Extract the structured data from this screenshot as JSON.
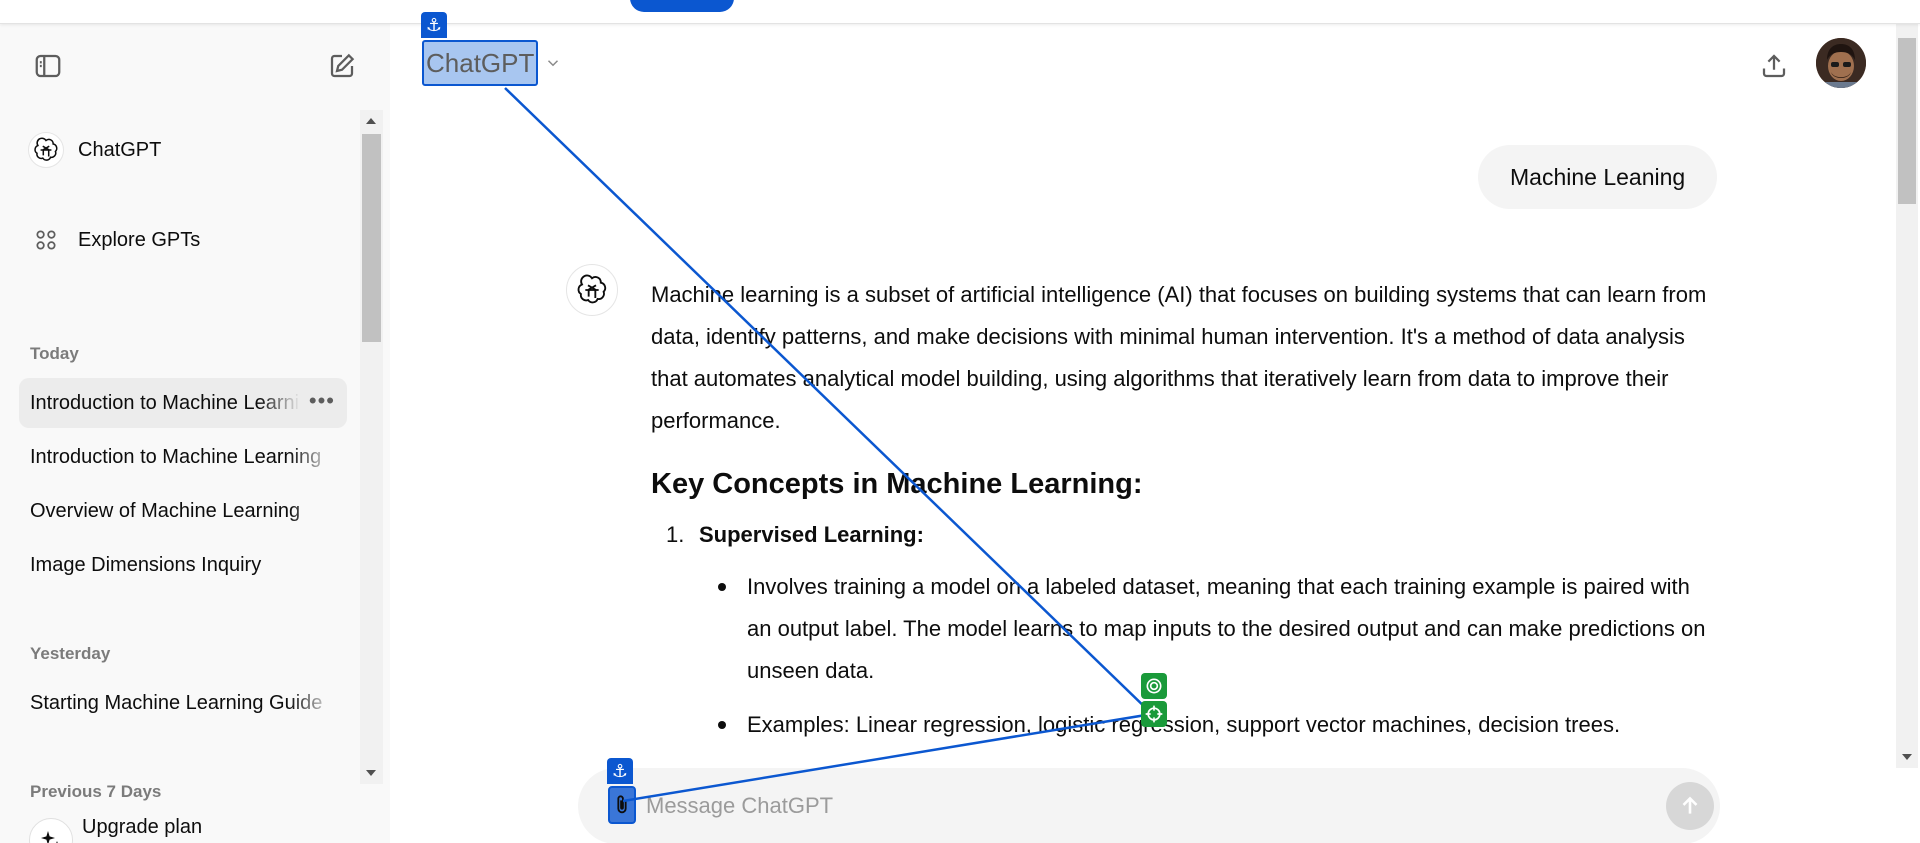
{
  "sidebar": {
    "toggle_icon": "sidebar-toggle-icon",
    "new_chat_icon": "pencil-square-icon",
    "top_items": [
      {
        "label": "ChatGPT",
        "icon": "openai-logo-icon"
      },
      {
        "label": "Explore GPTs",
        "icon": "grid-dots-icon"
      }
    ],
    "sections": [
      {
        "title": "Today",
        "chats": [
          "Introduction to Machine Learning",
          "Introduction to Machine Learning",
          "Overview of Machine Learning",
          "Image Dimensions Inquiry"
        ]
      },
      {
        "title": "Yesterday",
        "chats": [
          "Starting Machine Learning Guide"
        ]
      },
      {
        "title": "Previous 7 Days",
        "chats": []
      }
    ],
    "active_chat_more": "•••",
    "upgrade_label": "Upgrade plan",
    "upgrade_icon": "sparkles-icon"
  },
  "header": {
    "model_name": "ChatGPT",
    "chevron_icon": "chevron-down-icon",
    "share_icon": "share-upload-icon",
    "avatar_icon": "user-avatar"
  },
  "conversation": {
    "user_message": "Machine Leaning",
    "assistant": {
      "intro": "Machine learning is a subset of artificial intelligence (AI) that focuses on building systems that can learn from data, identify patterns, and make decisions with minimal human intervention. It's a method of data analysis that automates analytical model building, using algorithms that iteratively learn from data to improve their performance.",
      "heading": "Key Concepts in Machine Learning:",
      "items": [
        {
          "number": "1.",
          "title": "Supervised Learning:",
          "bullets": [
            "Involves training a model on a labeled dataset, meaning that each training example is paired with an output label. The model learns to map inputs to the desired output and can make predictions on unseen data.",
            "Examples: Linear regression, logistic regression, support vector machines, decision trees."
          ]
        }
      ]
    }
  },
  "composer": {
    "placeholder": "Message ChatGPT",
    "value": "",
    "attach_icon": "paperclip-icon",
    "send_icon": "arrow-up-icon"
  },
  "overlay": {
    "anchor_icon": "anchor-icon",
    "target_icon": "target-icon",
    "accent": "#0b57d0",
    "target_color": "#1a9a3a"
  },
  "colors": {
    "sidebar_bg": "#f9f9f9",
    "bubble_bg": "#f4f4f4",
    "text": "#0d0d0d",
    "muted": "#7b7b7b"
  }
}
